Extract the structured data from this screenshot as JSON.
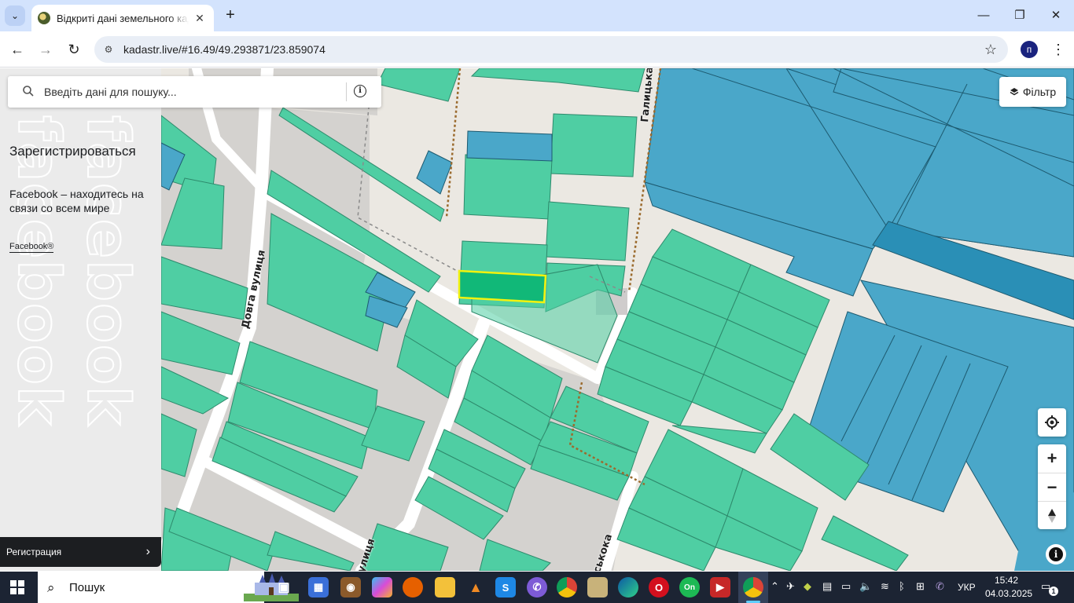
{
  "browser": {
    "tab_title": "Відкриті дані земельного кадастру",
    "tab_close": "✕",
    "new_tab": "+",
    "url": "kadastr.live/#16.49/49.293871/23.859074",
    "profile_letter": "п"
  },
  "map": {
    "search_placeholder": "Введіть дані для пошуку...",
    "filter_label": "Фільтр",
    "streets": {
      "dovha": "Довга вулиця",
      "halytska": "Галицька",
      "vulytsia": "улиця",
      "skoka": "ськока"
    },
    "colors": {
      "parcel": "#4fcea3",
      "parcel_blue": "#4aa7c9",
      "parcel_dark_blue": "#2a8fb6",
      "selected_outline": "#f2f20e",
      "road": "#ffffff",
      "background": "#ebe8e2",
      "boundary": "#9b6b2e"
    }
  },
  "ad": {
    "title": "Зарегистрироваться",
    "description": "Facebook – находитесь на связи со всем мире",
    "brand": "Facebook®",
    "watermark": "facebook",
    "cta": "Регистрация"
  },
  "taskbar": {
    "search_label": "Пошук",
    "language": "УКР",
    "time": "15:42",
    "date": "04.03.2025",
    "notification_count": "1"
  }
}
